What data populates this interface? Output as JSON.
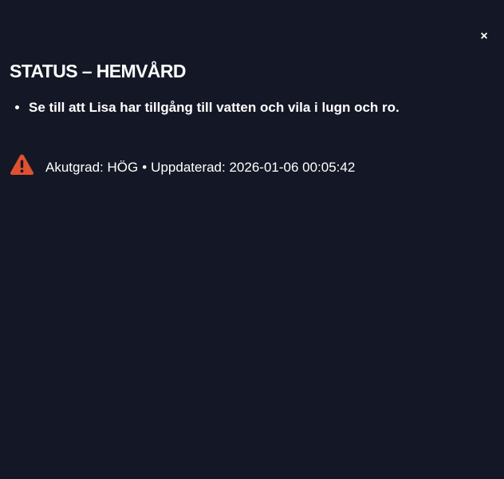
{
  "dialog": {
    "close_label": "×",
    "title": "STATUS – HEMVÅRD"
  },
  "instructions": [
    "Se till att Lisa har tillgång till vatten och vila i lugn och ro."
  ],
  "status": {
    "icon": "warning-triangle-icon",
    "urgency_text": "Akutgrad: HÖG",
    "separator": "•",
    "updated_text": "Uppdaterad: 2026-01-06 00:05:42"
  },
  "colors": {
    "background": "#141826",
    "text": "#ffffff",
    "warning": "#e0512f"
  }
}
